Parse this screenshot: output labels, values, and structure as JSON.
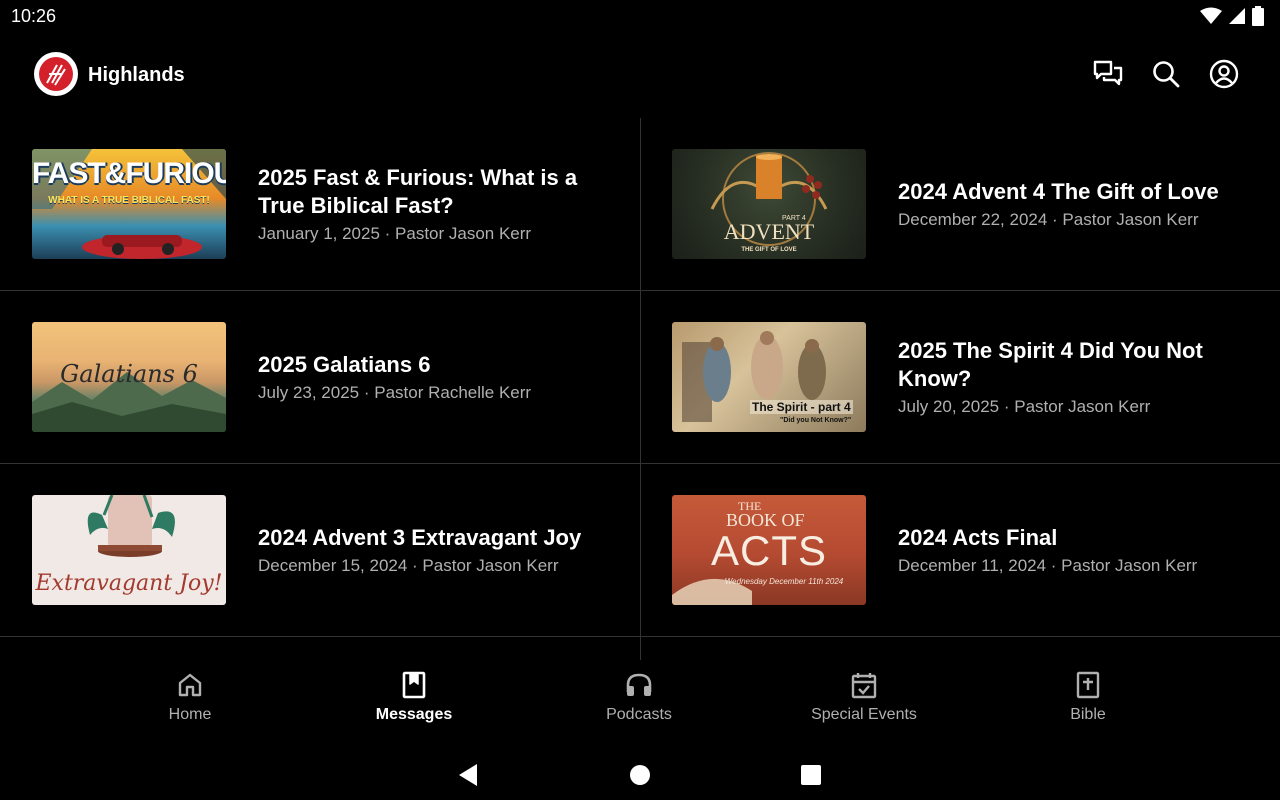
{
  "status": {
    "time": "10:26"
  },
  "app": {
    "title": "Highlands"
  },
  "icons": {
    "chat": "chat-icon",
    "search": "search-icon",
    "account": "account-icon"
  },
  "colors": {
    "accent": "#d3202a",
    "background": "#000000",
    "muted": "#b0b0b0"
  },
  "messages": [
    {
      "title": "2025 Fast & Furious: What is a True Biblical Fast?",
      "meta": "January 1, 2025 · Pastor Jason Kerr",
      "thumb_text": [
        "FAST&FURIOUS",
        "WHAT IS A TRUE BIBLICAL FAST!"
      ]
    },
    {
      "title": "2024 Advent 4 The Gift of Love",
      "meta": "December 22, 2024 · Pastor Jason Kerr",
      "thumb_text": [
        "ADVENT",
        "PART 4",
        "THE GIFT OF LOVE"
      ]
    },
    {
      "title": "2025 Galatians 6",
      "meta": "July 23, 2025 · Pastor Rachelle Kerr",
      "thumb_text": [
        "Galatians 6"
      ]
    },
    {
      "title": "2025 The Spirit 4 Did You Not Know?",
      "meta": "July 20, 2025 · Pastor Jason Kerr",
      "thumb_text": [
        "The Spirit - part 4",
        "\"Did you Not Know?\""
      ]
    },
    {
      "title": "2024 Advent 3 Extravagant Joy",
      "meta": "December 15, 2024 · Pastor Jason Kerr",
      "thumb_text": [
        "Extravagant Joy!"
      ]
    },
    {
      "title": "2024 Acts Final",
      "meta": "December 11, 2024 · Pastor Jason Kerr",
      "thumb_text": [
        "THE",
        "BOOK OF",
        "ACTS",
        "Wednesday December 11th 2024"
      ]
    }
  ],
  "nav": [
    {
      "label": "Home",
      "icon": "home-icon",
      "active": false
    },
    {
      "label": "Messages",
      "icon": "bookmark-icon",
      "active": true
    },
    {
      "label": "Podcasts",
      "icon": "headphones-icon",
      "active": false
    },
    {
      "label": "Special Events",
      "icon": "calendar-check-icon",
      "active": false
    },
    {
      "label": "Bible",
      "icon": "bible-icon",
      "active": false
    }
  ]
}
